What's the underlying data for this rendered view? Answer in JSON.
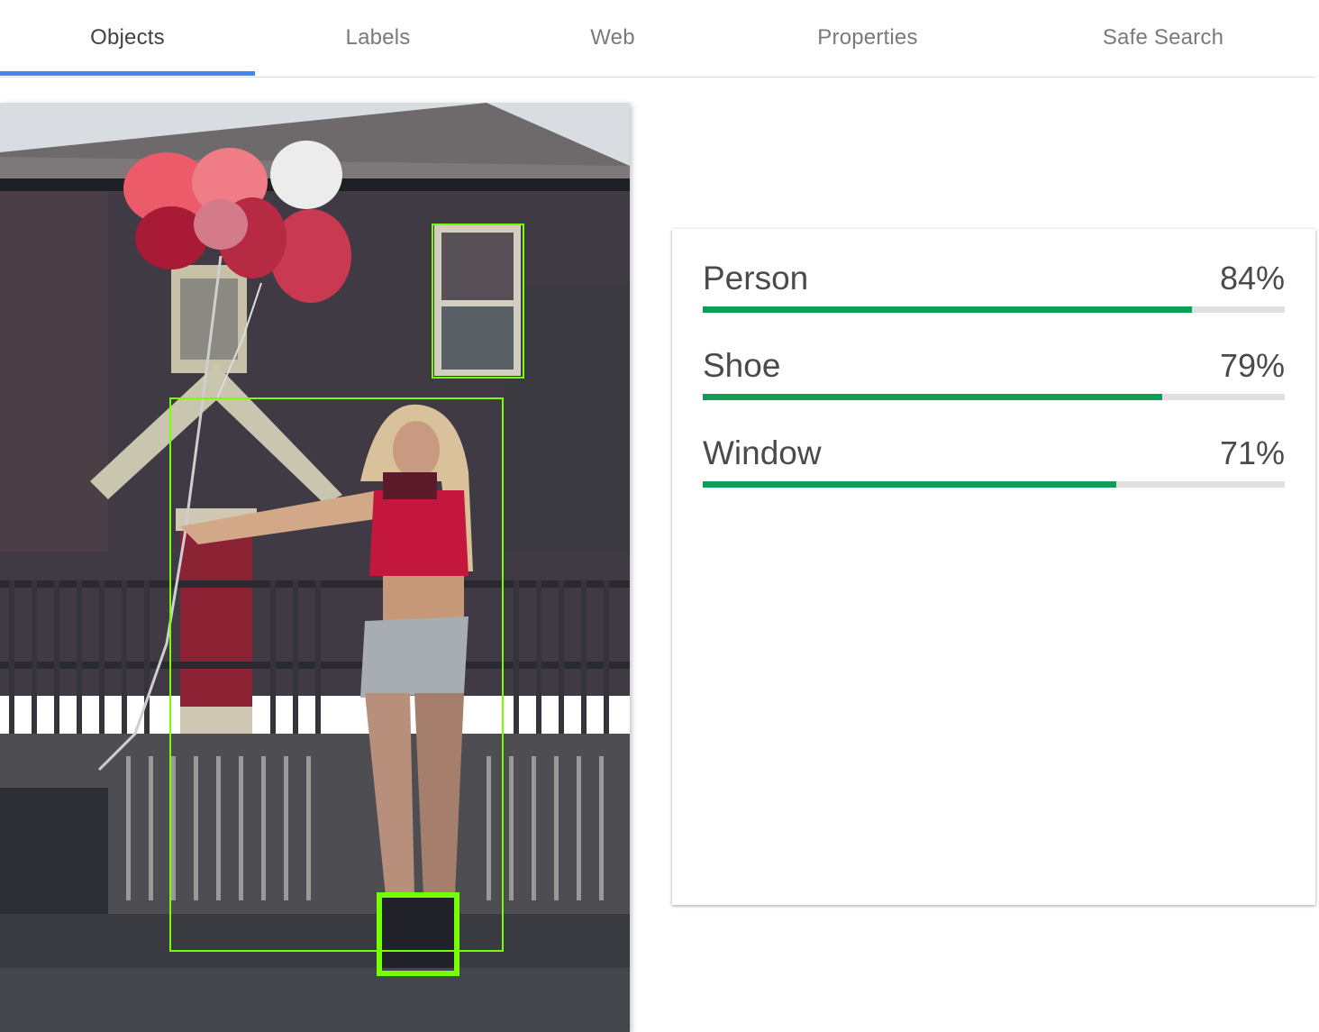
{
  "tabs": [
    {
      "label": "Objects",
      "active": true
    },
    {
      "label": "Labels",
      "active": false
    },
    {
      "label": "Web",
      "active": false
    },
    {
      "label": "Properties",
      "active": false
    },
    {
      "label": "Safe Search",
      "active": false
    }
  ],
  "colors": {
    "tab_indicator": "#4285f4",
    "score_bar": "#0f9d58",
    "bbox": "#76ff03"
  },
  "results": [
    {
      "label": "Person",
      "score": "84%",
      "value": 0.84
    },
    {
      "label": "Shoe",
      "score": "79%",
      "value": 0.79
    },
    {
      "label": "Window",
      "score": "71%",
      "value": 0.71
    }
  ]
}
